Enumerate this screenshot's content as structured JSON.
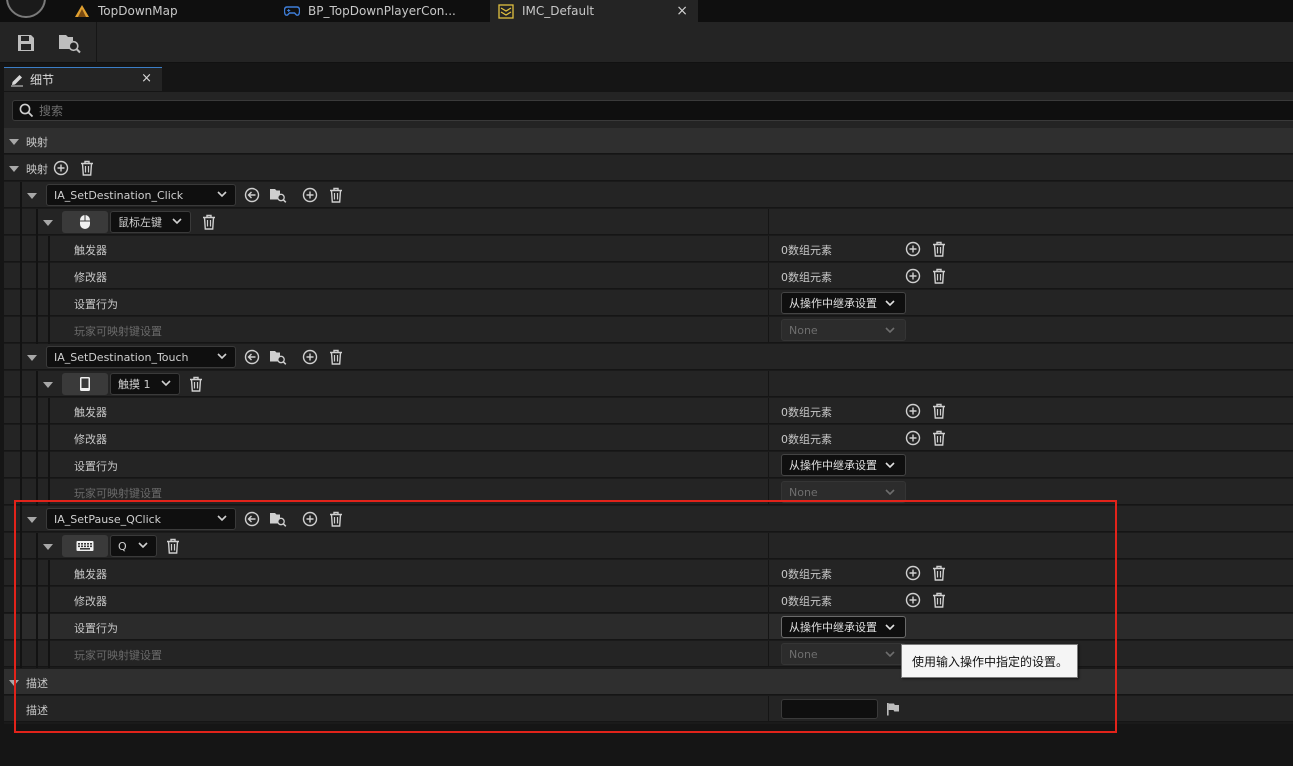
{
  "tabs": [
    {
      "label": "TopDownMap",
      "icon": "level-icon"
    },
    {
      "label": "BP_TopDownPlayerCon...",
      "icon": "gamepad-icon"
    },
    {
      "label": "IMC_Default",
      "icon": "input-mapping-icon"
    }
  ],
  "details": {
    "tab_label": "细节",
    "close": "×"
  },
  "search": {
    "placeholder": "搜索"
  },
  "categories": {
    "mappings": "映射",
    "description": "描述"
  },
  "mappings_header": "映射",
  "actions": [
    {
      "name": "IA_SetDestination_Click",
      "key": "鼠标左键",
      "key_icon": "mouse-icon"
    },
    {
      "name": "IA_SetDestination_Touch",
      "key": "触摸 1",
      "key_icon": "tablet-icon"
    },
    {
      "name": "IA_SetPause_QClick",
      "key": "Q",
      "key_icon": "keyboard-icon"
    }
  ],
  "props": {
    "triggers": "触发器",
    "modifiers": "修改器",
    "setting_behavior": "设置行为",
    "player_mappable": "玩家可映射键设置"
  },
  "values": {
    "array_elements": "0数组元素",
    "inherit": "从操作中继承设置",
    "none": "None"
  },
  "tooltip": "使用输入操作中指定的设置。",
  "description_label": "描述",
  "colors": {
    "highlight_box": "#e2231a",
    "active_tab_accent": "#3b7ec7"
  }
}
